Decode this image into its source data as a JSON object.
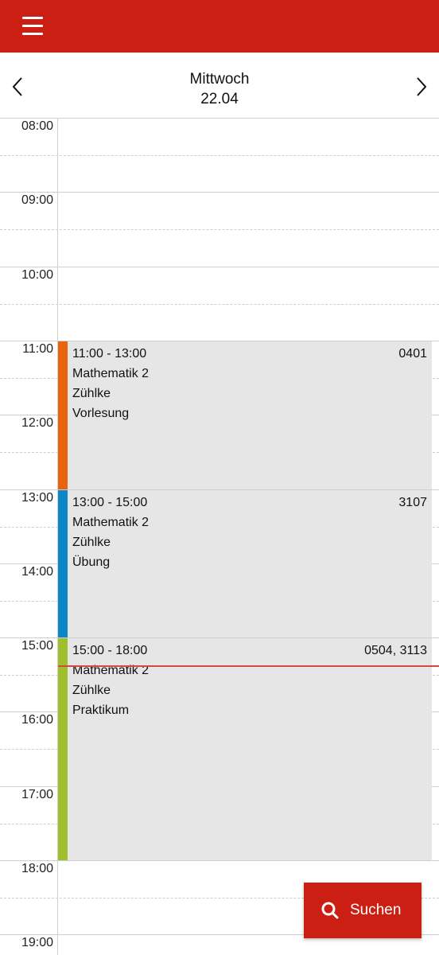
{
  "colors": {
    "primary": "#cc1f13",
    "event_bg": "#e6e6e6",
    "vorlesung": "#e8650d",
    "uebung": "#0b86c8",
    "praktikum": "#a0bf2d",
    "now_line": "#d44a3f"
  },
  "appbar": {
    "menu_icon": "hamburger-menu-icon"
  },
  "day_header": {
    "weekday": "Mittwoch",
    "date": "22.04",
    "prev_icon": "chevron-left-icon",
    "next_icon": "chevron-right-icon"
  },
  "hours": [
    "08:00",
    "09:00",
    "10:00",
    "11:00",
    "12:00",
    "13:00",
    "14:00",
    "15:00",
    "16:00",
    "17:00",
    "18:00",
    "19:00"
  ],
  "events": [
    {
      "time": "11:00 - 13:00",
      "title": "Mathematik 2",
      "person": "Zühlke",
      "type": "Vorlesung",
      "room": "0401",
      "color": "#e8650d",
      "start": "11:00",
      "end": "13:00"
    },
    {
      "time": "13:00 - 15:00",
      "title": "Mathematik 2",
      "person": "Zühlke",
      "type": "Übung",
      "room": "3107",
      "color": "#0b86c8",
      "start": "13:00",
      "end": "15:00"
    },
    {
      "time": "15:00 - 18:00",
      "title": "Mathematik 2",
      "person": "Zühlke",
      "type": "Praktikum",
      "room": "0504, 3113",
      "color": "#a0bf2d",
      "start": "15:00",
      "end": "18:00"
    }
  ],
  "search_button": {
    "label": "Suchen",
    "icon": "search-icon"
  }
}
